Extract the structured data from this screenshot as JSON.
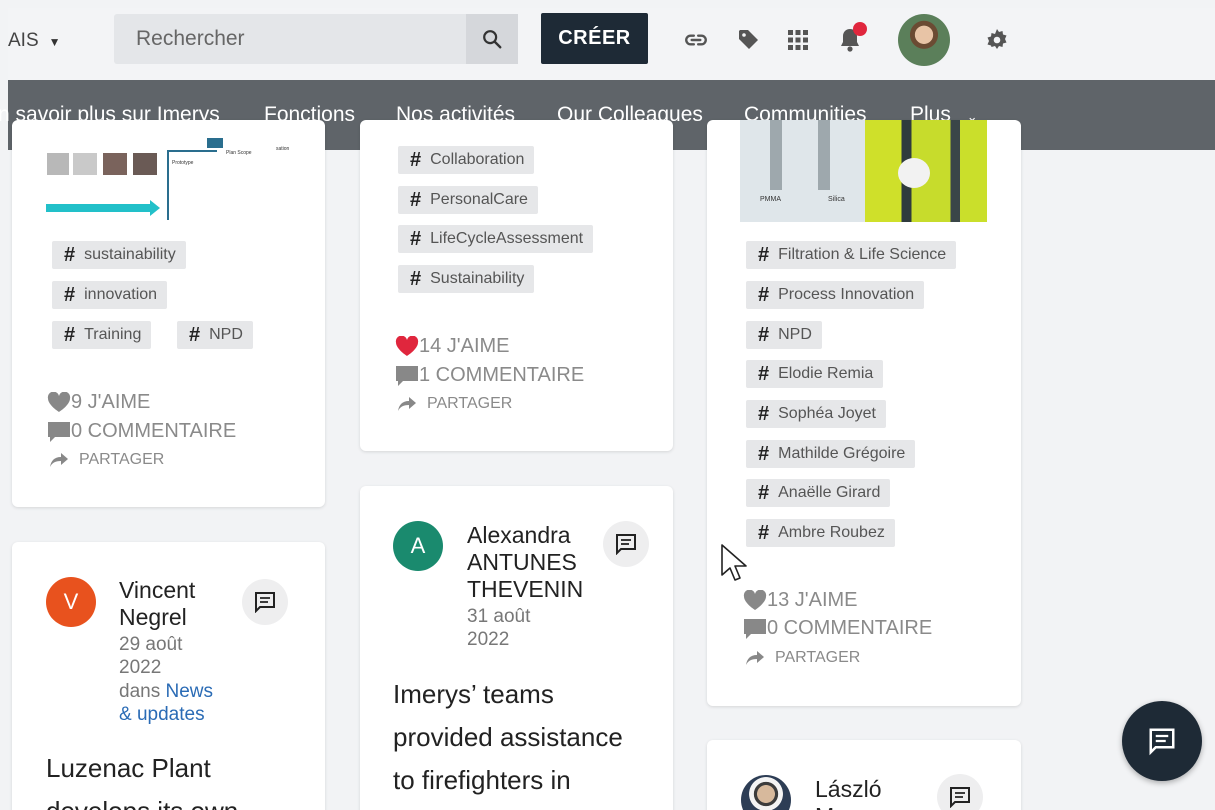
{
  "header": {
    "language": "AIS",
    "search_placeholder": "Rechercher",
    "create_label": "CRÉER",
    "icons": [
      "link-icon",
      "tag-icon",
      "apps-grid-icon",
      "bell-icon",
      "avatar",
      "gear-icon"
    ],
    "notification_color": "#e0263d"
  },
  "nav": {
    "items": [
      "n savoir plus sur Imerys",
      "Fonctions",
      "Nos activités",
      "Our Colleagues",
      "Communities"
    ],
    "more_label": "Plus"
  },
  "feed": {
    "card1": {
      "image_labels": [
        "Prototype",
        "Plan Scope",
        "sation"
      ],
      "tags": [
        "sustainability",
        "innovation",
        "Training",
        "NPD"
      ],
      "likes": "9 J'AIME",
      "comments": "0 COMMENTAIRE",
      "share": "PARTAGER"
    },
    "card2": {
      "tags": [
        "Collaboration",
        "PersonalCare",
        "LifeCycleAssessment",
        "Sustainability"
      ],
      "likes": "14 J'AIME",
      "comments": "1 COMMENTAIRE",
      "share": "PARTAGER"
    },
    "card3": {
      "image_labels": [
        "PMMA",
        "Silica"
      ],
      "tags": [
        "Filtration & Life Science",
        "Process Innovation",
        "NPD",
        "Elodie Remia",
        "Sophéa Joyet",
        "Mathilde Grégoire",
        "Anaëlle Girard",
        "Ambre Roubez"
      ],
      "likes": "13 J'AIME",
      "comments": "0 COMMENTAIRE",
      "share": "PARTAGER"
    },
    "post_vincent": {
      "avatar_letter": "V",
      "avatar_color": "#e8521e",
      "author_first": "Vincent",
      "author_last": "Negrel",
      "date_1": "29 août",
      "date_2": "2022",
      "in_label": "dans",
      "space_1": "News",
      "space_2": "& updates",
      "title_1": "Luzenac Plant",
      "title_2": "develops its own"
    },
    "post_alexandra": {
      "avatar_letter": "A",
      "avatar_color": "#1a8a6e",
      "author_1": "Alexandra",
      "author_2": "ANTUNES",
      "author_3": "THEVENIN",
      "date_1": "31 août",
      "date_2": "2022",
      "text_1": "Imerys’ teams",
      "text_2": "provided assistance",
      "text_3": "to firefighters in"
    },
    "post_laszlo": {
      "author_1": "László",
      "author_2": "M"
    }
  },
  "colors": {
    "nav_bg": "#5f6469",
    "create_bg": "#1e2a36",
    "like_active": "#e0263d",
    "link": "#2a6bb5"
  }
}
